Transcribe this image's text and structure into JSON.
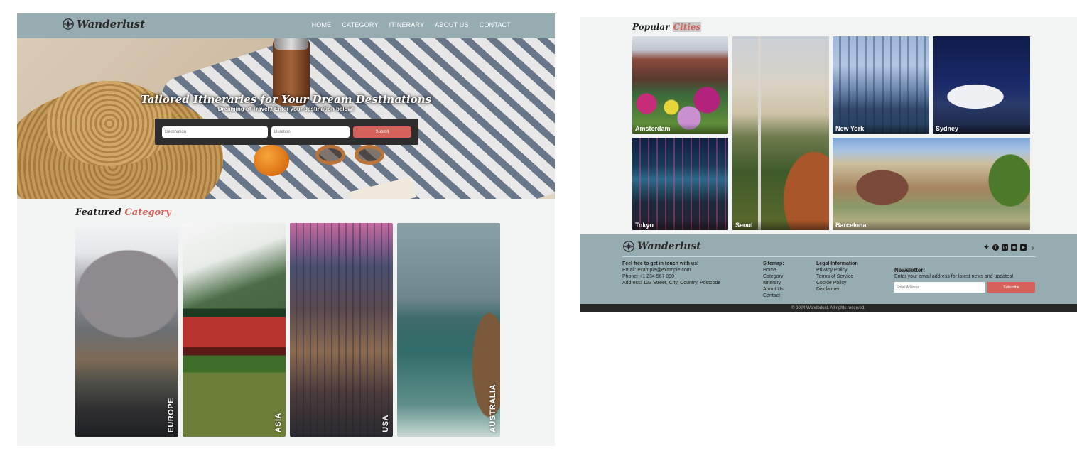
{
  "left_page": {
    "navbar": {
      "logo_text": "Wanderlust",
      "links": [
        "HOME",
        "CATEGORY",
        "ITINERARY",
        "ABOUT US",
        "CONTACT"
      ]
    },
    "hero": {
      "title": "Tailored Itineraries for Your Dream Destinations",
      "subtitle": "Dreaming of Travel? Enter your destination below!",
      "destination_placeholder": "Destination",
      "duration_placeholder": "Duration",
      "submit_label": "Submit"
    },
    "featured": {
      "title_prefix": "Featured",
      "title_accent": "Category",
      "categories": [
        "EUROPE",
        "ASIA",
        "USA",
        "AUSTRALIA"
      ]
    }
  },
  "right_page": {
    "popular": {
      "title_prefix": "Popular",
      "title_accent": "Cities",
      "cities": [
        "Amsterdam",
        "Seoul",
        "New York",
        "Sydney",
        "Tokyo",
        "Barcelona"
      ]
    },
    "footer": {
      "logo_text": "Wanderlust",
      "social_icons": [
        "twitter-icon",
        "facebook-icon",
        "linkedin-icon",
        "instagram-icon",
        "youtube-icon",
        "tiktok-icon"
      ],
      "contact": {
        "heading": "Feel free to get in touch with us!",
        "email": "Email: example@example.com",
        "phone": "Phone: +1 234 567 890",
        "address": "Address: 123 Street, City, Country, Postcode"
      },
      "sitemap": {
        "heading": "Sitemap:",
        "links": [
          "Home",
          "Category",
          "Itinerary",
          "About Us",
          "Contact"
        ]
      },
      "legal": {
        "heading": "Legal Information",
        "links": [
          "Privacy Policy",
          "Terms of Service",
          "Cookie Policy",
          "Disclaimer"
        ]
      },
      "newsletter": {
        "heading": "Newsletter:",
        "text": "Enter your email address for latest news and updates!",
        "email_placeholder": "Email Address",
        "subscribe_label": "Subscribe"
      },
      "copyright": "© 2024 Wanderlust. All rights reserved."
    }
  }
}
